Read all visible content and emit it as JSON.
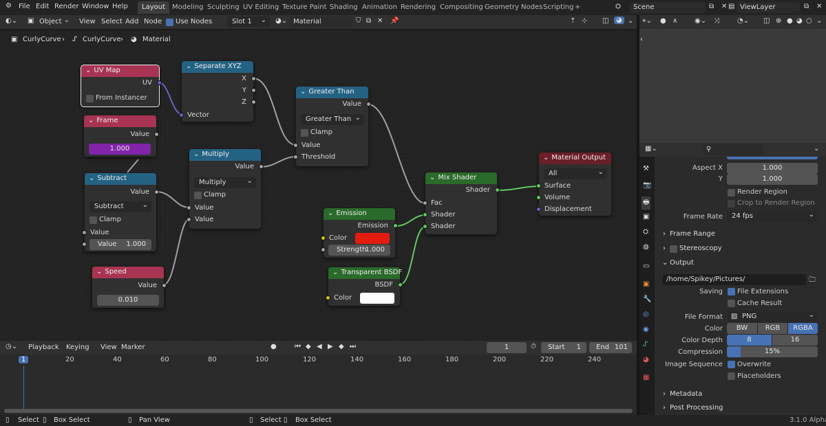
{
  "topbar": {
    "menus": [
      "File",
      "Edit",
      "Render",
      "Window",
      "Help"
    ],
    "workspaces": [
      "Layout",
      "Modeling",
      "Sculpting",
      "UV Editing",
      "Texture Paint",
      "Shading",
      "Animation",
      "Rendering",
      "Compositing",
      "Geometry Nodes",
      "Scripting"
    ],
    "add_tab": "+",
    "scene": "Scene",
    "view_layer": "ViewLayer"
  },
  "node_header": {
    "mode": "Object",
    "menus": [
      "View",
      "Select",
      "Add",
      "Node"
    ],
    "use_nodes": "Use Nodes",
    "slot": "Slot 1",
    "material": "Material"
  },
  "breadcrumb": [
    "CurlyCurve",
    "CurlyCurve",
    "Material"
  ],
  "nodes": {
    "uvmap": {
      "title": "UV Map",
      "out": "UV",
      "from_instancer": "From Instancer",
      "color": "#a83452"
    },
    "sepxyz": {
      "title": "Separate XYZ",
      "x": "X",
      "y": "Y",
      "z": "Z",
      "vector": "Vector",
      "color": "#246283"
    },
    "frame": {
      "title": "Frame",
      "value": "Value",
      "field": "1.000",
      "color": "#a83452",
      "field_color": "#8124a8"
    },
    "subtract": {
      "title": "Subtract",
      "out": "Value",
      "op": "Subtract",
      "clamp": "Clamp",
      "in1": "Value",
      "in2_label": "Value",
      "in2": "1.000",
      "color": "#246283"
    },
    "speed": {
      "title": "Speed",
      "out": "Value",
      "field": "0.010",
      "color": "#a83452"
    },
    "multiply": {
      "title": "Multiply",
      "out": "Value",
      "op": "Multiply",
      "clamp": "Clamp",
      "in1": "Value",
      "in2": "Value",
      "color": "#246283"
    },
    "greater": {
      "title": "Greater Than",
      "out": "Value",
      "op": "Greater Than",
      "clamp": "Clamp",
      "in1": "Value",
      "in2": "Threshold",
      "color": "#246283"
    },
    "emission": {
      "title": "Emission",
      "out": "Emission",
      "color_label": "Color",
      "strength_label": "Strength",
      "strength": "1.000",
      "color": "#2a6a2a",
      "swatch": "#e41c10"
    },
    "transparent": {
      "title": "Transparent BSDF",
      "out": "BSDF",
      "color_label": "Color",
      "color": "#2a6a2a",
      "swatch": "#ffffff"
    },
    "mix": {
      "title": "Mix Shader",
      "out": "Shader",
      "fac": "Fac",
      "s1": "Shader",
      "s2": "Shader",
      "color": "#2a6a2a"
    },
    "output": {
      "title": "Material Output",
      "target": "All",
      "surface": "Surface",
      "volume": "Volume",
      "displacement": "Displacement",
      "color": "#6b1f28"
    }
  },
  "timeline": {
    "menus": [
      "Playback",
      "Keying",
      "View",
      "Marker"
    ],
    "current_frame": "1",
    "start_label": "Start",
    "start": "1",
    "end_label": "End",
    "end": "101",
    "ticks": [
      "1",
      "20",
      "40",
      "60",
      "80",
      "100",
      "120",
      "140",
      "160",
      "180",
      "200",
      "220",
      "240"
    ]
  },
  "status": {
    "items": [
      "Select",
      "Box Select",
      "Pan View",
      "Select",
      "Box Select"
    ],
    "version": "3.1.0 Alpha"
  },
  "properties": {
    "aspect_x_label": "Aspect X",
    "aspect_x": "1.000",
    "aspect_y_label": "Y",
    "aspect_y": "1.000",
    "render_region": "Render Region",
    "crop_region": "Crop to Render Region",
    "frame_rate_label": "Frame Rate",
    "frame_rate": "24 fps",
    "frame_range": "Frame Range",
    "stereoscopy": "Stereoscopy",
    "output": "Output",
    "path": "/home/Spikey/Pictures/",
    "saving_label": "Saving",
    "file_ext": "File Extensions",
    "cache_result": "Cache Result",
    "file_format_label": "File Format",
    "file_format": "PNG",
    "color_label": "Color",
    "color_opts": [
      "BW",
      "RGB",
      "RGBA"
    ],
    "depth_label": "Color Depth",
    "depth_opts": [
      "8",
      "16"
    ],
    "compression_label": "Compression",
    "compression": "15%",
    "compression_value": 0.15,
    "image_seq_label": "Image Sequence",
    "overwrite": "Overwrite",
    "placeholders": "Placeholders",
    "metadata": "Metadata",
    "post_processing": "Post Processing"
  }
}
